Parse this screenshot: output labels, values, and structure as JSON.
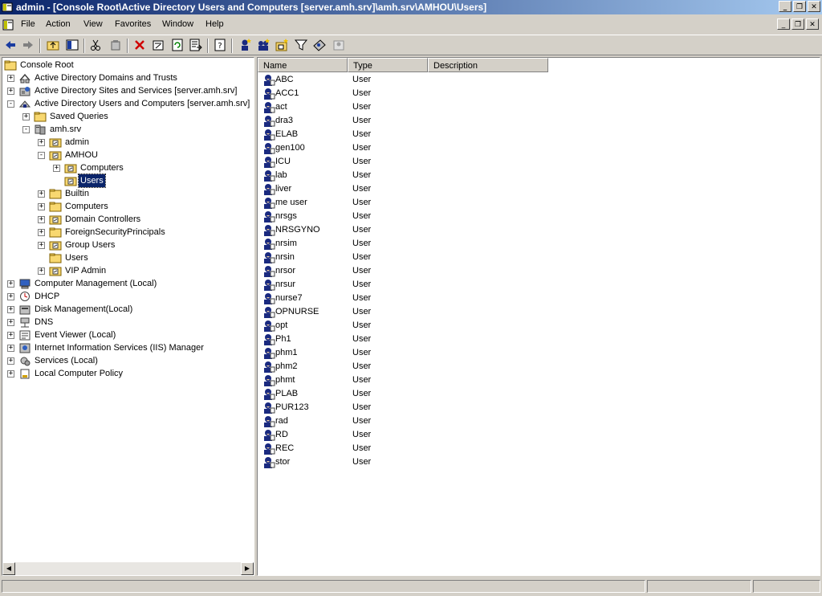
{
  "window": {
    "title": "admin - [Console Root\\Active Directory Users and Computers [server.amh.srv]\\amh.srv\\AMHOU\\Users]"
  },
  "caption_buttons": [
    "_",
    "❐",
    "✕"
  ],
  "menu": [
    "File",
    "Action",
    "View",
    "Favorites",
    "Window",
    "Help"
  ],
  "toolbar": [
    "back-icon",
    "forward-icon",
    "up-folder-icon",
    "show-tree-icon",
    "cut-icon",
    "copy-icon",
    "delete-icon",
    "properties-icon",
    "refresh-icon",
    "export-list-icon",
    "help-icon",
    "new-user-icon",
    "new-group-icon",
    "new-ou-icon",
    "filter-icon",
    "find-icon",
    "add-to-group-icon"
  ],
  "tree": {
    "nodes": [
      {
        "label": "Console Root",
        "level": 0,
        "expander": "",
        "icon": "folder"
      },
      {
        "label": "Active Directory Domains and Trusts",
        "level": 1,
        "expander": "+",
        "icon": "ad-trusts"
      },
      {
        "label": "Active Directory Sites and Services [server.amh.srv]",
        "level": 1,
        "expander": "+",
        "icon": "ad-sites"
      },
      {
        "label": "Active Directory Users and Computers [server.amh.srv]",
        "level": 1,
        "expander": "-",
        "icon": "ad-users"
      },
      {
        "label": "Saved Queries",
        "level": 2,
        "expander": "+",
        "icon": "folder"
      },
      {
        "label": "amh.srv",
        "level": 2,
        "expander": "-",
        "icon": "domain"
      },
      {
        "label": "admin",
        "level": 3,
        "expander": "+",
        "icon": "ou"
      },
      {
        "label": "AMHOU",
        "level": 3,
        "expander": "-",
        "icon": "ou"
      },
      {
        "label": "Computers",
        "level": 4,
        "expander": "+",
        "icon": "ou"
      },
      {
        "label": "Users",
        "level": 4,
        "expander": "",
        "icon": "ou",
        "selected": true
      },
      {
        "label": "Builtin",
        "level": 3,
        "expander": "+",
        "icon": "folder"
      },
      {
        "label": "Computers",
        "level": 3,
        "expander": "+",
        "icon": "folder"
      },
      {
        "label": "Domain Controllers",
        "level": 3,
        "expander": "+",
        "icon": "ou"
      },
      {
        "label": "ForeignSecurityPrincipals",
        "level": 3,
        "expander": "+",
        "icon": "folder"
      },
      {
        "label": "Group Users",
        "level": 3,
        "expander": "+",
        "icon": "ou"
      },
      {
        "label": "Users",
        "level": 3,
        "expander": "",
        "icon": "folder"
      },
      {
        "label": "VIP Admin",
        "level": 3,
        "expander": "+",
        "icon": "ou"
      },
      {
        "label": "Computer Management (Local)",
        "level": 1,
        "expander": "+",
        "icon": "computer"
      },
      {
        "label": "DHCP",
        "level": 1,
        "expander": "+",
        "icon": "dhcp"
      },
      {
        "label": "Disk Management(Local)",
        "level": 1,
        "expander": "+",
        "icon": "disk"
      },
      {
        "label": "DNS",
        "level": 1,
        "expander": "+",
        "icon": "dns"
      },
      {
        "label": "Event Viewer (Local)",
        "level": 1,
        "expander": "+",
        "icon": "event"
      },
      {
        "label": "Internet Information Services (IIS) Manager",
        "level": 1,
        "expander": "+",
        "icon": "iis"
      },
      {
        "label": "Services (Local)",
        "level": 1,
        "expander": "+",
        "icon": "services"
      },
      {
        "label": "Local Computer Policy",
        "level": 1,
        "expander": "+",
        "icon": "policy"
      }
    ]
  },
  "list": {
    "columns": [
      "Name",
      "Type",
      "Description"
    ],
    "rows": [
      {
        "name": "ABC",
        "type": "User"
      },
      {
        "name": "ACC1",
        "type": "User"
      },
      {
        "name": "act",
        "type": "User"
      },
      {
        "name": "dra3",
        "type": "User"
      },
      {
        "name": "ELAB",
        "type": "User"
      },
      {
        "name": "gen100",
        "type": "User"
      },
      {
        "name": "ICU",
        "type": "User"
      },
      {
        "name": "lab",
        "type": "User"
      },
      {
        "name": "liver",
        "type": "User"
      },
      {
        "name": "me user",
        "type": "User"
      },
      {
        "name": "nrsgs",
        "type": "User"
      },
      {
        "name": "NRSGYNO",
        "type": "User"
      },
      {
        "name": "nrsim",
        "type": "User"
      },
      {
        "name": "nrsin",
        "type": "User"
      },
      {
        "name": "nrsor",
        "type": "User"
      },
      {
        "name": "nrsur",
        "type": "User"
      },
      {
        "name": "nurse7",
        "type": "User"
      },
      {
        "name": "OPNURSE",
        "type": "User"
      },
      {
        "name": "opt",
        "type": "User"
      },
      {
        "name": "Ph1",
        "type": "User"
      },
      {
        "name": "phm1",
        "type": "User"
      },
      {
        "name": "phm2",
        "type": "User"
      },
      {
        "name": "phmt",
        "type": "User"
      },
      {
        "name": "PLAB",
        "type": "User"
      },
      {
        "name": "PUR123",
        "type": "User"
      },
      {
        "name": "rad",
        "type": "User"
      },
      {
        "name": "RD",
        "type": "User"
      },
      {
        "name": "REC",
        "type": "User"
      },
      {
        "name": "stor",
        "type": "User"
      }
    ]
  },
  "colors": {
    "title_active": "#0a246a",
    "title_gradient_end": "#a6caf0",
    "selection": "#0a246a",
    "face": "#d4d0c8"
  }
}
